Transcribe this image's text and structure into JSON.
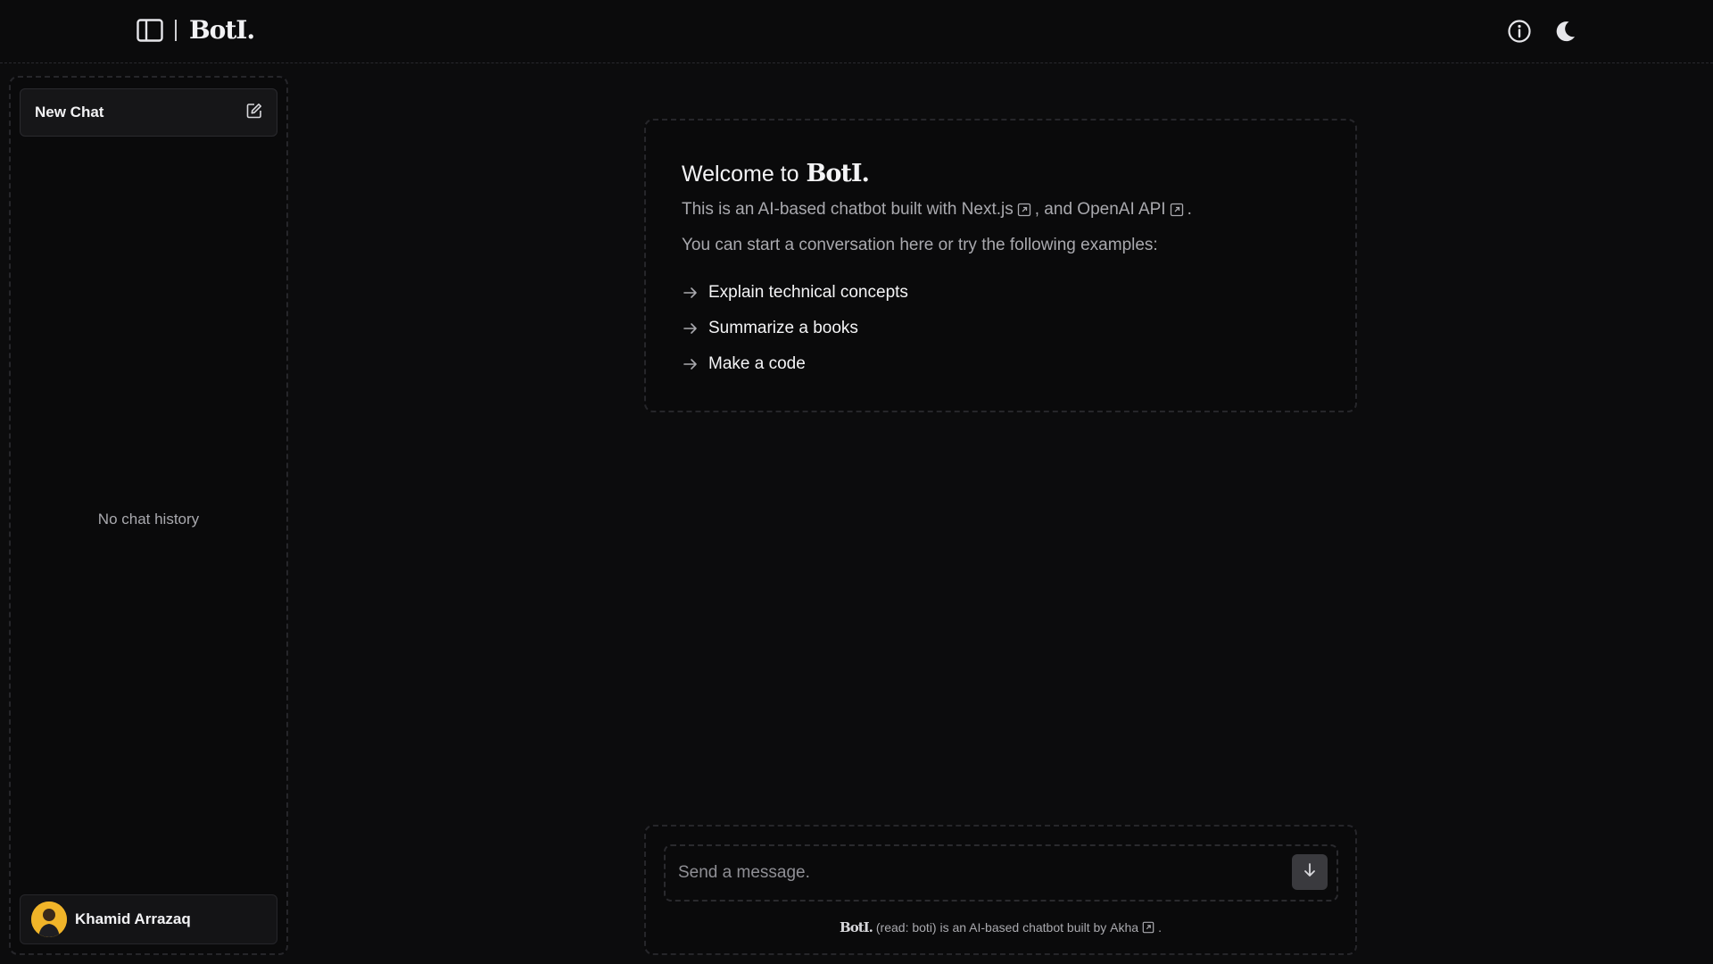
{
  "header": {
    "logo": "BotI.",
    "icons": {
      "sidebar_toggle": "sidebar-toggle-icon",
      "info": "info-icon",
      "theme": "moon-icon"
    }
  },
  "sidebar": {
    "new_chat_label": "New Chat",
    "new_chat_icon": "edit-icon",
    "empty_text": "No chat history",
    "user_name": "Khamid Arrazaq"
  },
  "welcome": {
    "title_prefix": "Welcome to",
    "title_logo": "BotI.",
    "intro_prefix": "This is an AI-based chatbot built with",
    "intro_link1": "Next.js",
    "intro_middle": ", and",
    "intro_link2": "OpenAI API",
    "intro_suffix": ".",
    "prompt_text": "You can start a conversation here or try the following examples:",
    "examples": [
      {
        "label": "Explain technical concepts"
      },
      {
        "label": "Summarize a books"
      },
      {
        "label": "Make a code"
      }
    ]
  },
  "composer": {
    "placeholder": "Send a message.",
    "send_icon": "arrow-down-icon",
    "footnote_logo": "BotI.",
    "footnote_text": "(read: boti) is an AI-based chatbot built by",
    "footnote_link": "Akha",
    "footnote_suffix": "."
  },
  "colors": {
    "background": "#0c0c0d",
    "panel": "#0a0a0b",
    "text_primary": "#f4f4f6",
    "text_muted": "#a9a9ae",
    "avatar_bg": "#f0b429"
  }
}
